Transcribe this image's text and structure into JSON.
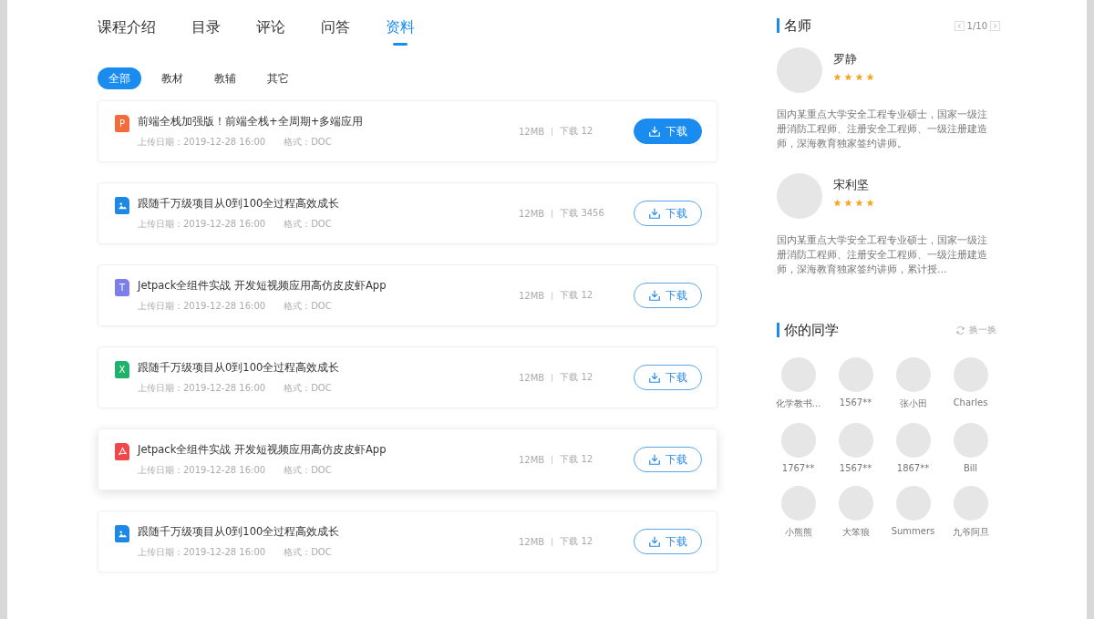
{
  "tabs": [
    {
      "label": "课程介绍",
      "selected": false
    },
    {
      "label": "目录",
      "selected": false
    },
    {
      "label": "评论",
      "selected": false
    },
    {
      "label": "问答",
      "selected": false
    },
    {
      "label": "资料",
      "selected": true
    }
  ],
  "filters": [
    {
      "label": "全部",
      "selected": true
    },
    {
      "label": "教材",
      "selected": false
    },
    {
      "label": "教辅",
      "selected": false
    },
    {
      "label": "其它",
      "selected": false
    }
  ],
  "files": [
    {
      "kind": "ppt",
      "letter": "P",
      "title": "前端全栈加强版！前端全栈+全周期+多端应用",
      "date": "上传日期：2019-12-28  16:00",
      "format": "格式：DOC",
      "size": "12MB",
      "downloads": "下载 12",
      "button": "下载",
      "primary": true,
      "hovered": false
    },
    {
      "kind": "image",
      "title": "跟随千万级项目从0到100全过程高效成长",
      "date": "上传日期：2019-12-28  16:00",
      "format": "格式：DOC",
      "size": "12MB",
      "downloads": "下载 3456",
      "button": "下载",
      "primary": false,
      "hovered": false
    },
    {
      "kind": "text",
      "letter": "T",
      "title": "Jetpack全组件实战 开发短视频应用高仿皮皮虾App",
      "date": "上传日期：2019-12-28  16:00",
      "format": "格式：DOC",
      "size": "12MB",
      "downloads": "下载 12",
      "button": "下载",
      "primary": false,
      "hovered": false
    },
    {
      "kind": "sheet",
      "letter": "X",
      "title": "跟随千万级项目从0到100全过程高效成长",
      "date": "上传日期：2019-12-28  16:00",
      "format": "格式：DOC",
      "size": "12MB",
      "downloads": "下载 12",
      "button": "下载",
      "primary": false,
      "hovered": false
    },
    {
      "kind": "pdf",
      "title": "Jetpack全组件实战 开发短视频应用高仿皮皮虾App",
      "date": "上传日期：2019-12-28  16:00",
      "format": "格式：DOC",
      "size": "12MB",
      "downloads": "下载 12",
      "button": "下载",
      "primary": false,
      "hovered": true
    },
    {
      "kind": "image",
      "title": "跟随千万级项目从0到100全过程高效成长",
      "date": "上传日期：2019-12-28  16:00",
      "format": "格式：DOC",
      "size": "12MB",
      "downloads": "下载 12",
      "button": "下载",
      "primary": false,
      "hovered": false
    }
  ],
  "teachers_panel": {
    "title": "名师",
    "pager": "1/10",
    "teachers": [
      {
        "name": "罗静",
        "stars": 4,
        "bio": "国内某重点大学安全工程专业硕士，国家一级注册消防工程师、注册安全工程师、一级注册建造师，深海教育独家签约讲师。"
      },
      {
        "name": "宋利坚",
        "stars": 4,
        "bio": "国内某重点大学安全工程专业硕士，国家一级注册消防工程师、注册安全工程师、一级注册建造师，深海教育独家签约讲师，累计授..."
      }
    ]
  },
  "classmates_panel": {
    "title": "你的同学",
    "refresh": "换一换",
    "classmates": [
      {
        "name": "化学教书..."
      },
      {
        "name": "1567**"
      },
      {
        "name": "张小田"
      },
      {
        "name": "Charles"
      },
      {
        "name": "1767**"
      },
      {
        "name": "1567**"
      },
      {
        "name": "1867**"
      },
      {
        "name": "Bill"
      },
      {
        "name": "小熊熊"
      },
      {
        "name": "大笨狼"
      },
      {
        "name": "Summers"
      },
      {
        "name": "九爷阿旦"
      }
    ]
  }
}
